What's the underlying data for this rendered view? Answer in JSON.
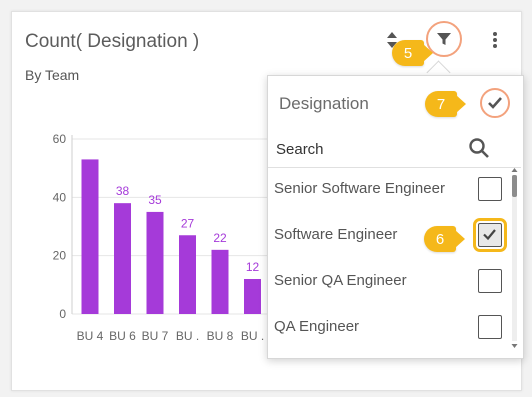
{
  "widget": {
    "title": "Count( Designation )",
    "subtitle": "By Team"
  },
  "toolbar": {
    "sort_icon": "sort-icon",
    "filter_icon": "filter-icon",
    "more_icon": "more-vertical-icon"
  },
  "annotations": {
    "filter_step": "5",
    "checkbox_step": "6",
    "apply_step": "7"
  },
  "filter_popup": {
    "title": "Designation",
    "search_placeholder": "Search",
    "apply_icon": "check-icon",
    "options": [
      {
        "label": "Senior Software Engineer",
        "checked": false
      },
      {
        "label": "Software Engineer",
        "checked": true
      },
      {
        "label": "Senior QA Engineer",
        "checked": false
      },
      {
        "label": "QA Engineer",
        "checked": false
      }
    ]
  },
  "colors": {
    "bar": "#a53ad9",
    "data_label": "#a53ad9",
    "badge": "#f5b81a",
    "highlight_ring": "#f3a27d"
  },
  "chart_data": {
    "type": "bar",
    "categories": [
      "BU 4",
      "BU 6",
      "BU 7",
      "BU .",
      "BU 8",
      "BU ."
    ],
    "values": [
      53,
      38,
      35,
      27,
      22,
      12
    ],
    "data_labels": [
      "",
      "38",
      "35",
      "27",
      "22",
      "12"
    ],
    "yticks": [
      0,
      20,
      40,
      60
    ],
    "ylim": [
      0,
      60
    ],
    "grid": true
  }
}
